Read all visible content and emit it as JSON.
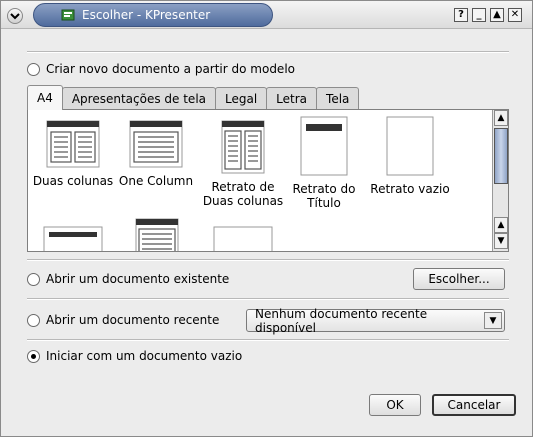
{
  "window": {
    "title": "Escolher - KPresenter",
    "controls": [
      "?",
      "_",
      "▲",
      "✕"
    ]
  },
  "options": {
    "new_from_template": "Criar novo documento a partir do modelo",
    "open_existing": "Abrir um documento existente",
    "open_recent": "Abrir um documento recente",
    "start_empty": "Iniciar com um documento vazio"
  },
  "tabs": [
    "A4",
    "Apresentações de tela",
    "Legal",
    "Letra",
    "Tela"
  ],
  "templates": [
    {
      "label": "Duas colunas"
    },
    {
      "label": "One Column"
    },
    {
      "label": "Retrato de Duas colunas"
    },
    {
      "label": "Retrato do Título"
    },
    {
      "label": "Retrato vazio"
    }
  ],
  "buttons": {
    "choose": "Escolher...",
    "ok": "OK",
    "cancel": "Cancelar"
  },
  "recent_combo": {
    "selected": "Nenhum documento recente disponível"
  },
  "selected_option": "start_empty"
}
